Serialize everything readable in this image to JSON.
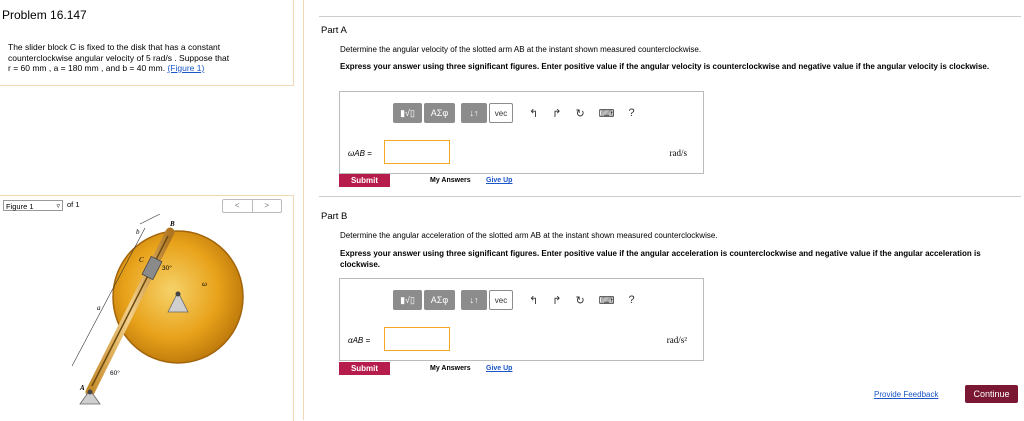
{
  "problem": {
    "title": "Problem 16.147",
    "text_line1": "The slider block C is fixed to the disk that has a constant",
    "text_line2": "counterclockwise angular velocity of 5  rad/s . Suppose that",
    "text_line3": "r = 60  mm , a = 180  mm , and b = 40 mm.",
    "figure_link": "(Figure 1)"
  },
  "figure": {
    "select_value": "Figure 1",
    "of_label": "of 1",
    "prev_label": "<",
    "next_label": ">",
    "labels": {
      "B": "B",
      "b": "b",
      "C": "C",
      "angle30": "30°",
      "omega": "ω",
      "a": "a",
      "A": "A",
      "angle60": "60°"
    }
  },
  "partA": {
    "title": "Part A",
    "question": "Determine the angular velocity of the slotted arm AB at the instant shown measured counterclockwise.",
    "instruction": "Express your answer using three significant figures. Enter positive value if the angular velocity is counterclockwise and negative value if the angular velocity is clockwise.",
    "answer_label": "ωAB =",
    "answer_value": "",
    "unit": "rad/s",
    "submit_label": "Submit",
    "my_answers_label": "My Answers",
    "give_up_label": "Give Up"
  },
  "partB": {
    "title": "Part B",
    "question": "Determine the angular acceleration of the slotted arm AB at the instant shown measured counterclockwise.",
    "instruction": "Express your answer using three significant figures. Enter positive value if the angular acceleration is counterclockwise and negative value if the angular acceleration is clockwise.",
    "answer_label": "αAB =",
    "answer_value": "",
    "unit": "rad/s²",
    "submit_label": "Submit",
    "my_answers_label": "My Answers",
    "give_up_label": "Give Up"
  },
  "toolbar": {
    "templates_icon": "▮√▯",
    "greek_label": "ΑΣφ",
    "arrows_label": "↓↑",
    "vec_label": "vec",
    "undo_icon": "↰",
    "redo_icon": "↱",
    "reset_icon": "↻",
    "keyboard_icon": "⌨",
    "help_icon": "?"
  },
  "footer": {
    "feedback_label": "Provide Feedback",
    "continue_label": "Continue"
  },
  "colors": {
    "submit": "#b71d4c",
    "continue": "#7a1833",
    "link": "#1a56c8",
    "disk": "#e8a21a"
  }
}
